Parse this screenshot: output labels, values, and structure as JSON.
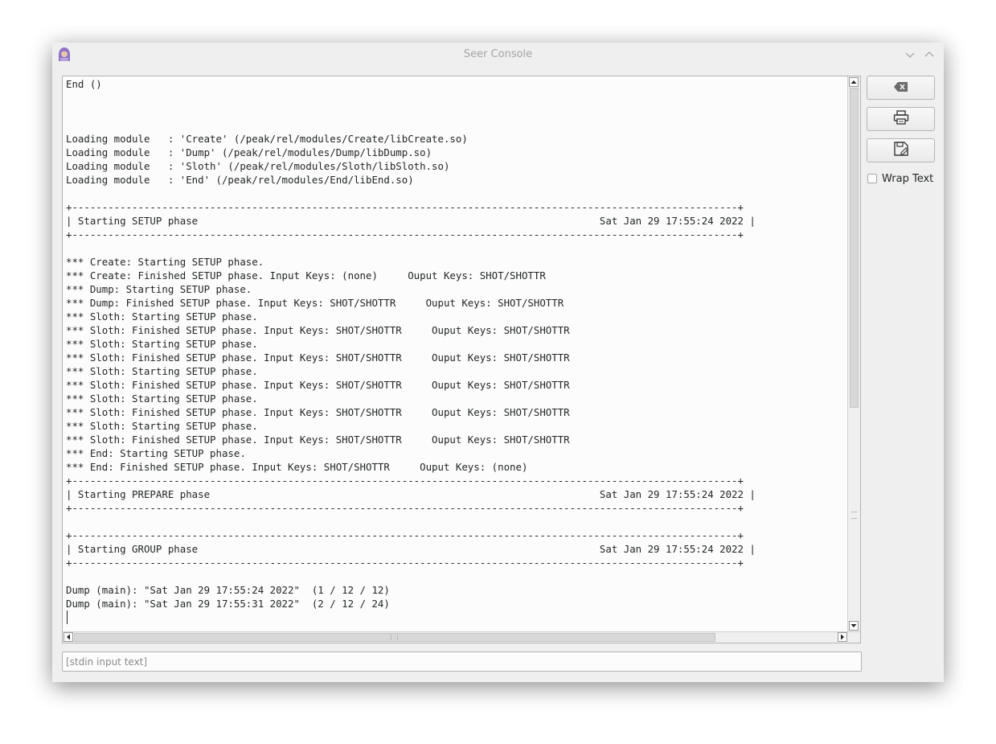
{
  "window": {
    "title": "Seer Console"
  },
  "console": {
    "text": "End ()\n\n\n\nLoading module   : 'Create' (/peak/rel/modules/Create/libCreate.so)\nLoading module   : 'Dump' (/peak/rel/modules/Dump/libDump.so)\nLoading module   : 'Sloth' (/peak/rel/modules/Sloth/libSloth.so)\nLoading module   : 'End' (/peak/rel/modules/End/libEnd.so)\n\n+---------------------------------------------------------------------------------------------------------------+\n| Starting SETUP phase                                                                   Sat Jan 29 17:55:24 2022 |\n+---------------------------------------------------------------------------------------------------------------+\n\n*** Create: Starting SETUP phase.\n*** Create: Finished SETUP phase. Input Keys: (none)     Ouput Keys: SHOT/SHOTTR\n*** Dump: Starting SETUP phase.\n*** Dump: Finished SETUP phase. Input Keys: SHOT/SHOTTR     Ouput Keys: SHOT/SHOTTR\n*** Sloth: Starting SETUP phase.\n*** Sloth: Finished SETUP phase. Input Keys: SHOT/SHOTTR     Ouput Keys: SHOT/SHOTTR\n*** Sloth: Starting SETUP phase.\n*** Sloth: Finished SETUP phase. Input Keys: SHOT/SHOTTR     Ouput Keys: SHOT/SHOTTR\n*** Sloth: Starting SETUP phase.\n*** Sloth: Finished SETUP phase. Input Keys: SHOT/SHOTTR     Ouput Keys: SHOT/SHOTTR\n*** Sloth: Starting SETUP phase.\n*** Sloth: Finished SETUP phase. Input Keys: SHOT/SHOTTR     Ouput Keys: SHOT/SHOTTR\n*** Sloth: Starting SETUP phase.\n*** Sloth: Finished SETUP phase. Input Keys: SHOT/SHOTTR     Ouput Keys: SHOT/SHOTTR\n*** End: Starting SETUP phase.\n*** End: Finished SETUP phase. Input Keys: SHOT/SHOTTR     Ouput Keys: (none)\n+---------------------------------------------------------------------------------------------------------------+\n| Starting PREPARE phase                                                                 Sat Jan 29 17:55:24 2022 |\n+---------------------------------------------------------------------------------------------------------------+\n\n+---------------------------------------------------------------------------------------------------------------+\n| Starting GROUP phase                                                                   Sat Jan 29 17:55:24 2022 |\n+---------------------------------------------------------------------------------------------------------------+\n\nDump (main): \"Sat Jan 29 17:55:24 2022\"  (1 / 12 / 12)\nDump (main): \"Sat Jan 29 17:55:31 2022\"  (2 / 12 / 24)"
  },
  "sidebar": {
    "clear_icon": "backspace-clear-icon",
    "print_icon": "printer-icon",
    "save_icon": "save-icon",
    "wrap_label": "Wrap Text",
    "wrap_checked": false
  },
  "stdin": {
    "placeholder": "[stdin input text]",
    "value": ""
  },
  "colors": {
    "window_bg": "#efefef",
    "console_bg": "#fcfcfc",
    "text": "#232627",
    "title_text": "#a4a4a4"
  }
}
